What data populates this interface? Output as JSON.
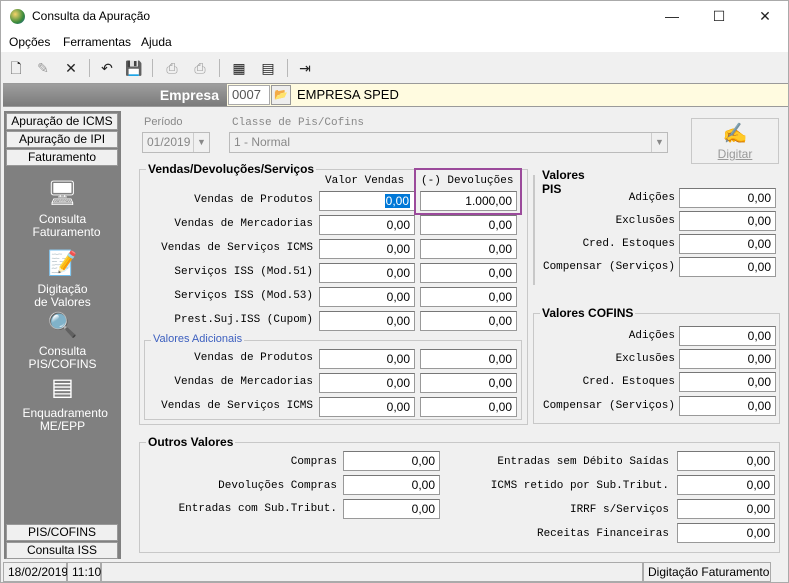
{
  "window": {
    "title": "Consulta da Apuração",
    "minimize": "—",
    "maximize": "☐",
    "close": "✕"
  },
  "menu": [
    "Opções",
    "Ferramentas",
    "Ajuda"
  ],
  "empresa": {
    "label": "Empresa",
    "code": "0007",
    "name": "EMPRESA SPED"
  },
  "sidebar": {
    "tabs_top": [
      "Apuração de ICMS",
      "Apuração de IPI",
      "Faturamento"
    ],
    "items": [
      "Consulta Faturamento",
      "Digitação de Valores",
      "Consulta PIS/COFINS",
      "Enquadramento ME/EPP"
    ],
    "tabs_bottom": [
      "PIS/COFINS",
      "Consulta ISS"
    ]
  },
  "periodo": {
    "label": "Período",
    "value": "01/2019"
  },
  "classe": {
    "label": "Classe de Pis/Cofins",
    "value": "1 - Normal"
  },
  "digitar": "Digitar",
  "vendas": {
    "title": "Vendas/Devoluções/Serviços",
    "col_vendas": "Valor Vendas",
    "col_devol": "(-) Devoluções",
    "rows": [
      {
        "label": "Vendas de Produtos",
        "vendas": "0,00",
        "devol": "1.000,00"
      },
      {
        "label": "Vendas de Mercadorias",
        "vendas": "0,00",
        "devol": "0,00"
      },
      {
        "label": "Vendas de Serviços ICMS",
        "vendas": "0,00",
        "devol": "0,00"
      },
      {
        "label": "Serviços ISS (Mod.51)",
        "vendas": "0,00",
        "devol": "0,00"
      },
      {
        "label": "Serviços ISS (Mod.53)",
        "vendas": "0,00",
        "devol": "0,00"
      },
      {
        "label": "Prest.Suj.ISS (Cupom)",
        "vendas": "0,00",
        "devol": "0,00"
      }
    ],
    "adicionais": {
      "title": "Valores Adicionais",
      "rows": [
        {
          "label": "Vendas de Produtos",
          "vendas": "0,00",
          "devol": "0,00"
        },
        {
          "label": "Vendas de Mercadorias",
          "vendas": "0,00",
          "devol": "0,00"
        },
        {
          "label": "Vendas de Serviços ICMS",
          "vendas": "0,00",
          "devol": "0,00"
        }
      ]
    }
  },
  "pis": {
    "title": "Valores PIS",
    "rows": [
      {
        "label": "Adições",
        "value": "0,00"
      },
      {
        "label": "Exclusões",
        "value": "0,00"
      },
      {
        "label": "Cred. Estoques",
        "value": "0,00"
      },
      {
        "label": "Compensar (Serviços)",
        "value": "0,00"
      }
    ]
  },
  "cofins": {
    "title": "Valores COFINS",
    "rows": [
      {
        "label": "Adições",
        "value": "0,00"
      },
      {
        "label": "Exclusões",
        "value": "0,00"
      },
      {
        "label": "Cred. Estoques",
        "value": "0,00"
      },
      {
        "label": "Compensar (Serviços)",
        "value": "0,00"
      }
    ]
  },
  "outros": {
    "title": "Outros Valores",
    "left": [
      {
        "label": "Compras",
        "value": "0,00"
      },
      {
        "label": "Devoluções Compras",
        "value": "0,00"
      },
      {
        "label": "Entradas com Sub.Tribut.",
        "value": "0,00"
      }
    ],
    "right": [
      {
        "label": "Entradas sem Débito Saídas",
        "value": "0,00"
      },
      {
        "label": "ICMS retido por Sub.Tribut.",
        "value": "0,00"
      },
      {
        "label": "IRRF s/Serviços",
        "value": "0,00"
      },
      {
        "label": "Receitas Financeiras",
        "value": "0,00"
      }
    ]
  },
  "status": {
    "date": "18/02/2019",
    "time": "11:10",
    "mode": "Digitação Faturamento"
  }
}
